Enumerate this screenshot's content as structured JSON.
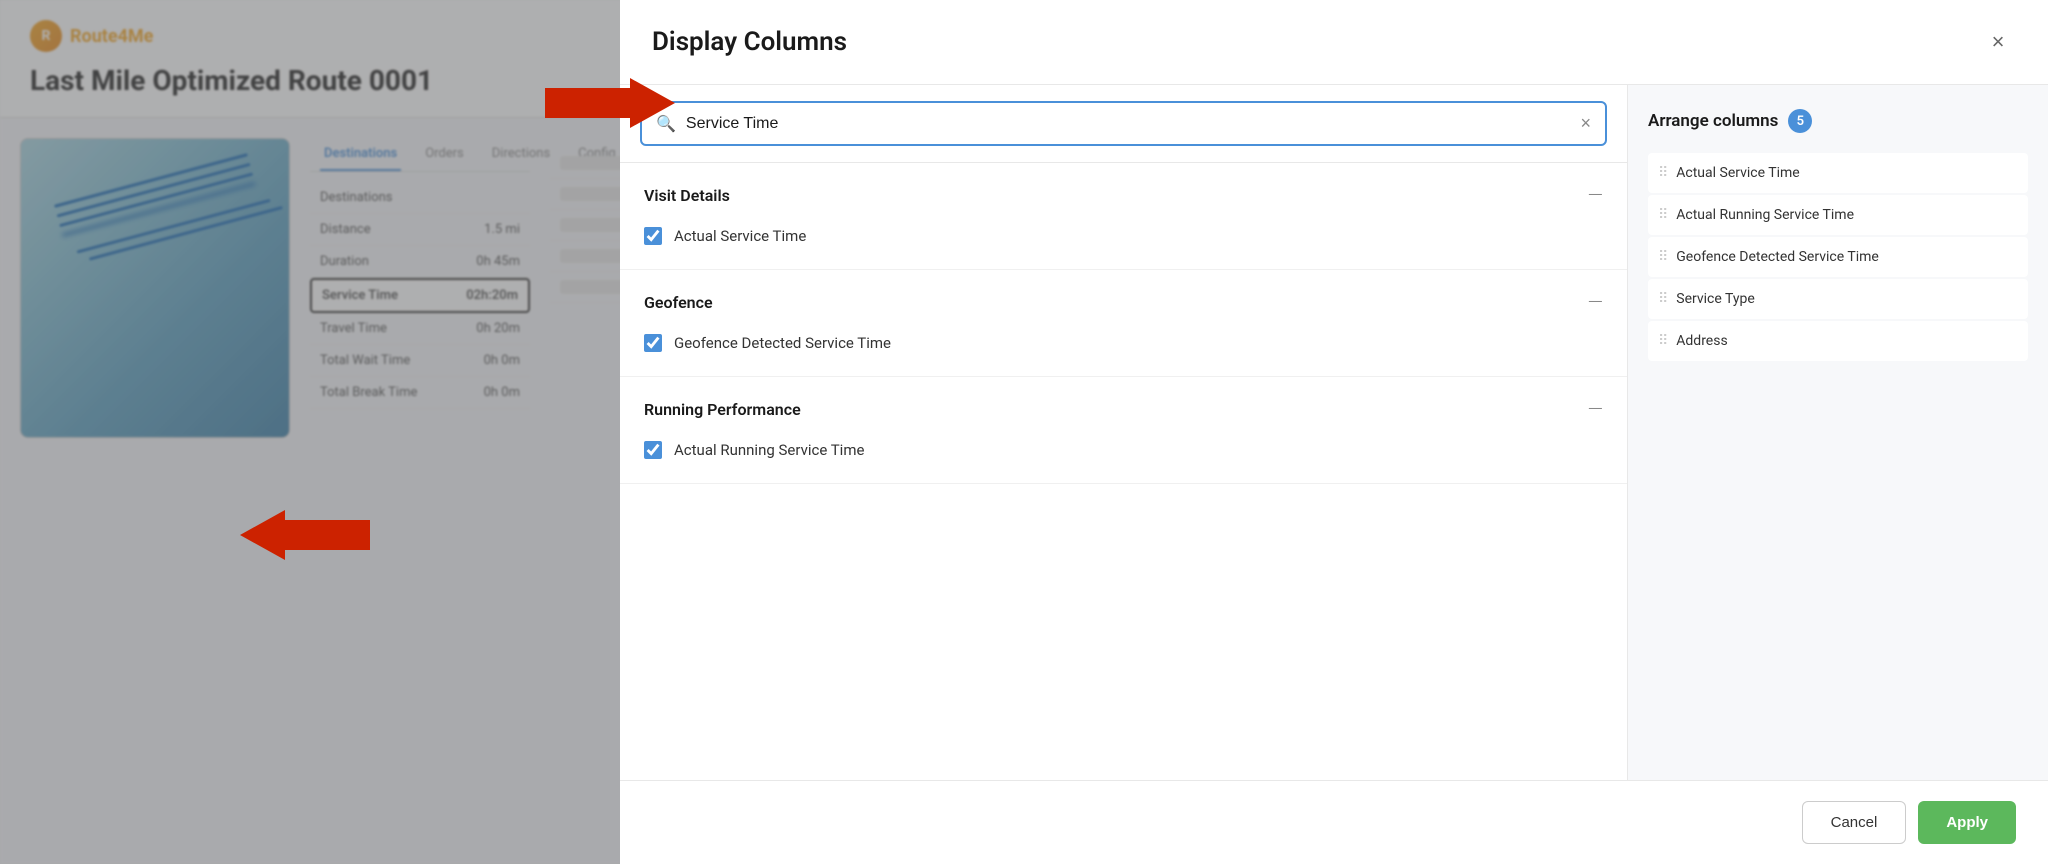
{
  "page": {
    "title": "Last Mile Optimized Route 0001"
  },
  "modal": {
    "title": "Display Columns",
    "close_label": "×",
    "search": {
      "placeholder": "Service Time",
      "value": "Service Time",
      "clear_label": "×"
    },
    "sections": [
      {
        "id": "visit-details",
        "title": "Visit Details",
        "collapse_icon": "—",
        "items": [
          {
            "id": "actual-service-time",
            "label": "Actual Service Time",
            "checked": true
          }
        ]
      },
      {
        "id": "geofence",
        "title": "Geofence",
        "collapse_icon": "—",
        "items": [
          {
            "id": "geofence-detected-service-time",
            "label": "Geofence Detected Service Time",
            "checked": true
          }
        ]
      },
      {
        "id": "running-performance",
        "title": "Running Performance",
        "collapse_icon": "—",
        "items": [
          {
            "id": "actual-running-service-time",
            "label": "Actual Running Service Time",
            "checked": true
          }
        ]
      }
    ],
    "arrange": {
      "title": "Arrange columns",
      "count": 5,
      "items": [
        {
          "id": "col-1",
          "label": "Actual Service Time"
        },
        {
          "id": "col-2",
          "label": "Actual Running Service Time"
        },
        {
          "id": "col-3",
          "label": "Geofence Detected Service Time"
        },
        {
          "id": "col-4",
          "label": "Service Type"
        },
        {
          "id": "col-5",
          "label": "Address"
        }
      ]
    },
    "footer": {
      "cancel_label": "Cancel",
      "apply_label": "Apply"
    }
  },
  "background": {
    "route_title": "Last Mile Optimized Route 0001",
    "sidebar_items": [
      {
        "label": "Destinations",
        "value": ""
      },
      {
        "label": "Distance",
        "value": "1.5 mi"
      },
      {
        "label": "Duration",
        "value": "0h 45m"
      },
      {
        "label": "Service Time",
        "value": "02h:20m",
        "highlighted": true
      },
      {
        "label": "Travel Time",
        "value": "0h 20m"
      },
      {
        "label": "Total Wait Time",
        "value": "0h 0m"
      },
      {
        "label": "Total Break Time",
        "value": "0h 0m"
      }
    ],
    "nav_tabs": [
      {
        "label": "Destinations",
        "active": true
      },
      {
        "label": "Orders",
        "active": false
      },
      {
        "label": "Directions",
        "active": false
      },
      {
        "label": "Config",
        "active": false
      }
    ]
  },
  "colors": {
    "accent_blue": "#4a90d9",
    "accent_green": "#5cb85c",
    "checkbox_blue": "#4a90d9",
    "arrow_red": "#cc2200"
  }
}
